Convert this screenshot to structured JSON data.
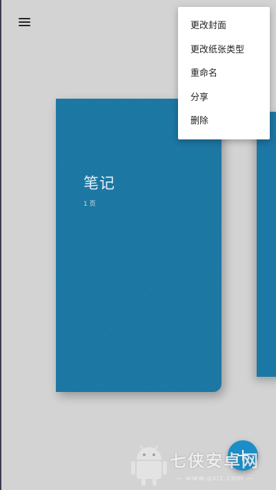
{
  "header": {
    "menu_icon": "hamburger-menu-icon"
  },
  "notebook": {
    "title": "笔记",
    "pages": "1 页",
    "cover_color": "#1b77a4"
  },
  "context_menu": {
    "items": [
      {
        "label": "更改封面"
      },
      {
        "label": "更改纸张类型"
      },
      {
        "label": "重命名"
      },
      {
        "label": "分享"
      },
      {
        "label": "删除"
      }
    ]
  },
  "fab": {
    "icon": "plus-icon",
    "color": "#1b8ec8"
  },
  "watermark": {
    "text": "七侠安卓网",
    "url": "— www.qxlz.com —",
    "logo": "android-robot-logo"
  }
}
